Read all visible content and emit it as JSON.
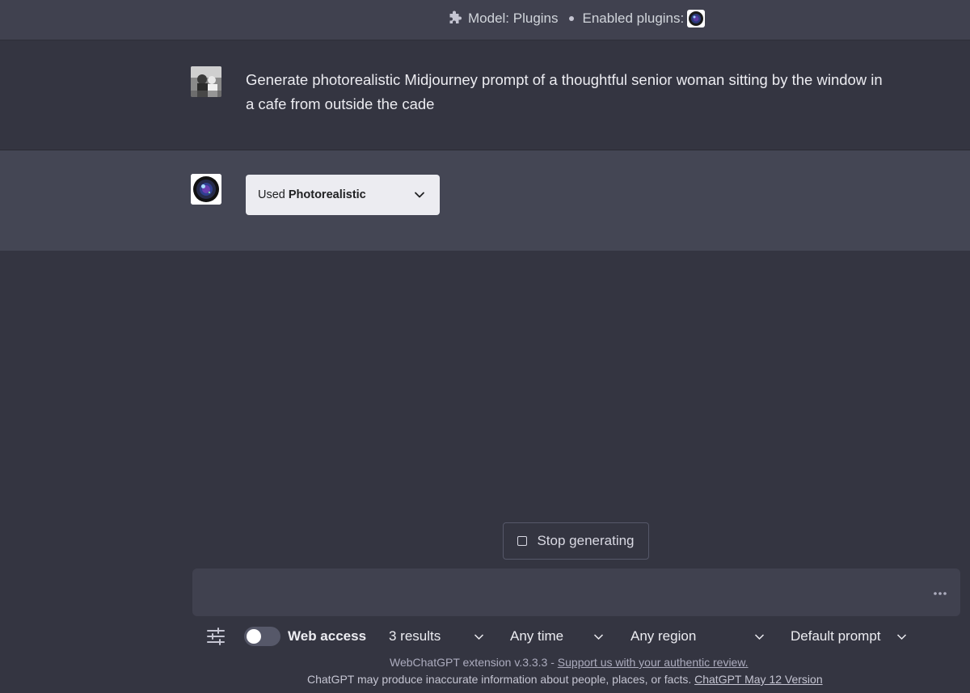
{
  "header": {
    "model_label": "Model: Plugins",
    "enabled_plugins_label": "Enabled plugins:",
    "icons": [
      "puzzle-icon",
      "camera-lens-icon"
    ]
  },
  "conversation": {
    "user_message": "Generate photorealistic Midjourney prompt of a thoughtful senior woman sitting by the window in a cafe from outside the cade",
    "assistant": {
      "plugin_used_prefix": "Used",
      "plugin_name": "Photorealistic"
    }
  },
  "stop_button": {
    "label": "Stop generating"
  },
  "composer": {
    "placeholder": "",
    "value": ""
  },
  "toolbar": {
    "web_access_label": "Web access",
    "web_access_enabled": false,
    "results": "3 results",
    "time": "Any time",
    "region": "Any region",
    "prompt": "Default prompt"
  },
  "footer": {
    "extension_text": "WebChatGPT extension v.3.3.3 - ",
    "extension_link": "Support us with your authentic review.",
    "disclaimer_text": "ChatGPT may produce inaccurate information about people, places, or facts. ",
    "version_link": "ChatGPT May 12 Version"
  },
  "colors": {
    "background": "#343541",
    "assistant_row": "#444654",
    "topbar": "#40414f",
    "pill": "#ececf1"
  }
}
